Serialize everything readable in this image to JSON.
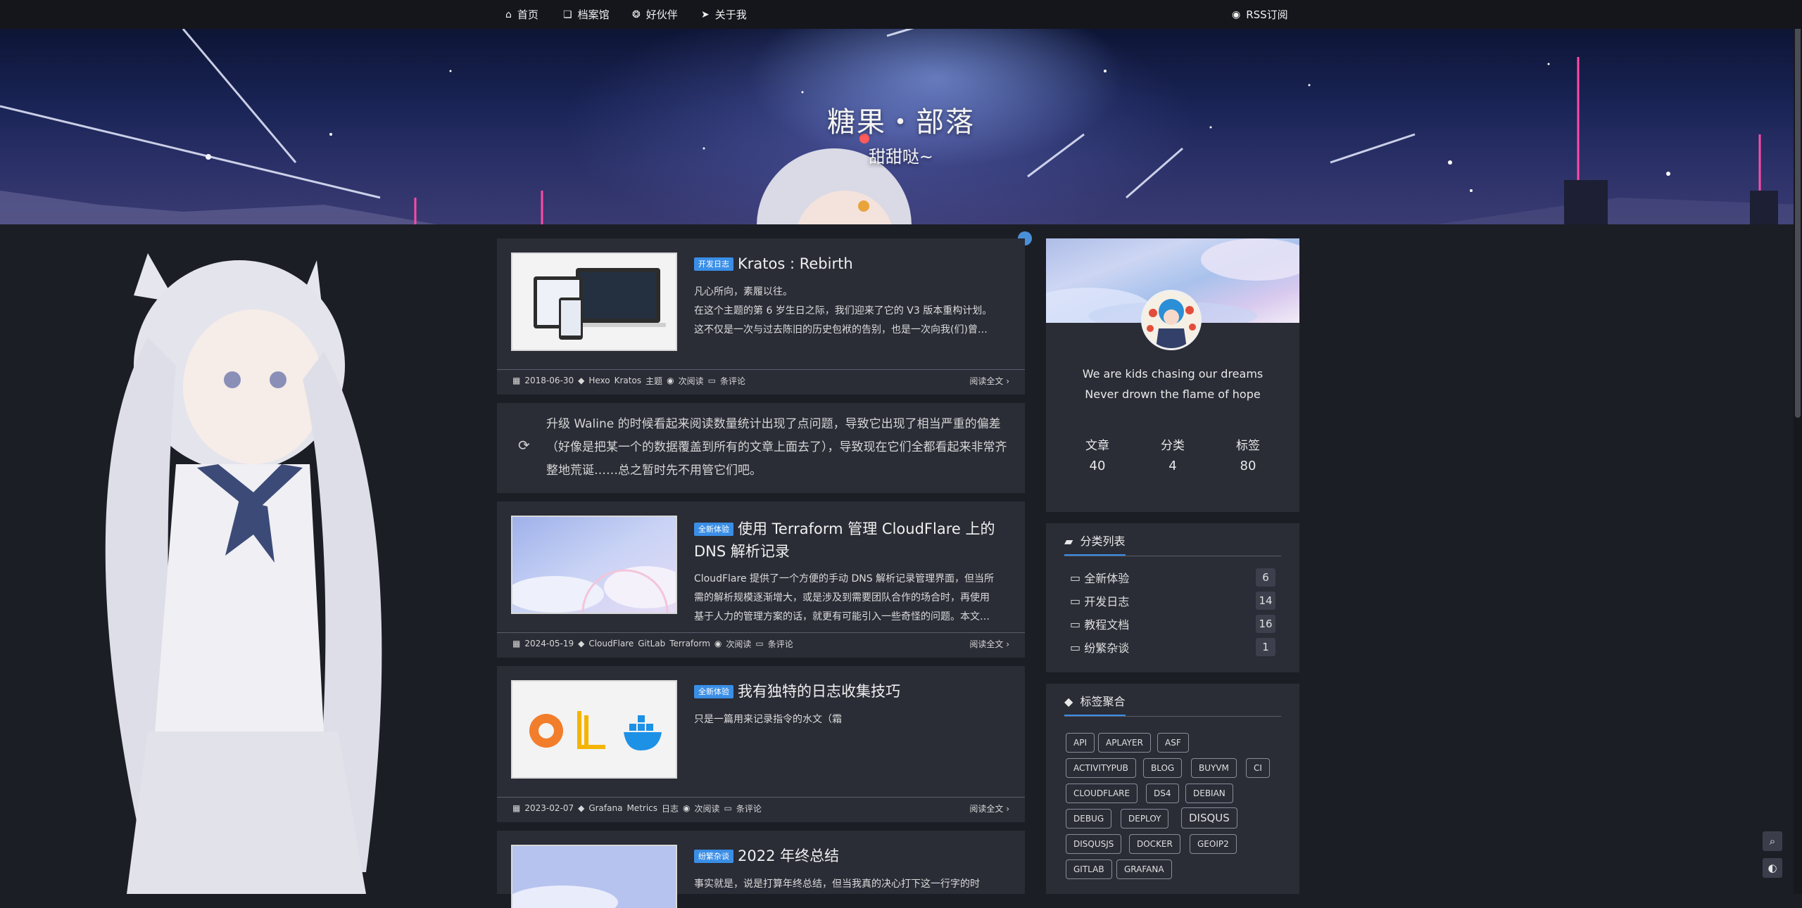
{
  "nav": {
    "items": [
      {
        "icon": "home-icon",
        "label": "首页"
      },
      {
        "icon": "book-icon",
        "label": "档案馆"
      },
      {
        "icon": "paw-icon",
        "label": "好伙伴"
      },
      {
        "icon": "paper-plane-icon",
        "label": "关于我"
      }
    ],
    "rss": {
      "icon": "rss-icon",
      "label": "RSS订阅"
    }
  },
  "header": {
    "title": "糖果・部落",
    "subtitle": "甜甜哒~"
  },
  "posts": [
    {
      "category": "开发日志",
      "title": "Kratos : Rebirth",
      "excerpt": [
        "凡心所向，素履以往。",
        "在这个主题的第 6 岁生日之际，我们迎来了它的 V3 版本重构计划。",
        "这不仅是一次与过去陈旧的历史包袱的告别，也是一次向我(们)曾…"
      ],
      "date": "2018-06-30",
      "tags": [
        "Hexo",
        "Kratos",
        "主题"
      ],
      "views": "次阅读",
      "comments": "条评论",
      "read_more": "阅读全文"
    },
    {
      "category": "全新体验",
      "title": "使用 Terraform 管理 CloudFlare 上的 DNS 解析记录",
      "excerpt": [
        "CloudFlare 提供了一个方便的手动 DNS 解析记录管理界面，但当所",
        "需的解析规模逐渐增大，或是涉及到需要团队合作的场合时，再使用",
        "基于人力的管理方案的话，就更有可能引入一些奇怪的问题。本文…"
      ],
      "date": "2024-05-19",
      "tags": [
        "CloudFlare",
        "GitLab",
        "Terraform"
      ],
      "views": "次阅读",
      "comments": "条评论",
      "read_more": "阅读全文"
    },
    {
      "category": "全新体验",
      "title": "我有独特的日志收集技巧",
      "excerpt": [
        "只是一篇用来记录指令的水文（霜"
      ],
      "date": "2023-02-07",
      "tags": [
        "Grafana",
        "Metrics",
        "日志"
      ],
      "views": "次阅读",
      "comments": "条评论",
      "read_more": "阅读全文"
    },
    {
      "category": "纷繁杂谈",
      "title": "2022 年终总结",
      "excerpt": [
        "事实就是，说是打算年终总结，但当我真的决心打下这一行字的时"
      ]
    }
  ],
  "quote": {
    "icon": "refresh-icon",
    "text": "升级 Waline 的时候看起来阅读数量统计出现了点问题，导致它出现了相当严重的偏差（好像是把某一个的数据覆盖到所有的文章上面去了），导致现在它们全都看起来非常齐整地荒诞……总之暂时先不用管它们吧。"
  },
  "profile": {
    "motto": [
      "We are kids chasing our dreams",
      "Never drown the flame of hope"
    ],
    "stats": [
      {
        "label": "文章",
        "value": "40"
      },
      {
        "label": "分类",
        "value": "4"
      },
      {
        "label": "标签",
        "value": "80"
      }
    ]
  },
  "categories_widget": {
    "title": "分类列表",
    "items": [
      {
        "name": "全新体验",
        "count": "6"
      },
      {
        "name": "开发日志",
        "count": "14"
      },
      {
        "name": "教程文档",
        "count": "16"
      },
      {
        "name": "纷繁杂谈",
        "count": "1"
      }
    ]
  },
  "tags_widget": {
    "title": "标签聚合",
    "tags": [
      "API",
      "APLAYER",
      "ASF",
      "ACTIVITYPUB",
      "BLOG",
      "BUYVM",
      "CI",
      "CLOUDFLARE",
      "DS4",
      "DEBIAN",
      "DEBUG",
      "DEPLOY",
      "DISQUS",
      "DISQUSJS",
      "DOCKER",
      "GEOIP2",
      "GITLAB",
      "GRAFANA"
    ]
  },
  "floating": {
    "search_icon": "search-icon",
    "theme_icon": "contrast-icon"
  },
  "colors": {
    "accent": "#3a8ee6",
    "card": "#2a2c36",
    "page": "#1c1e26",
    "nav": "#15161c"
  }
}
